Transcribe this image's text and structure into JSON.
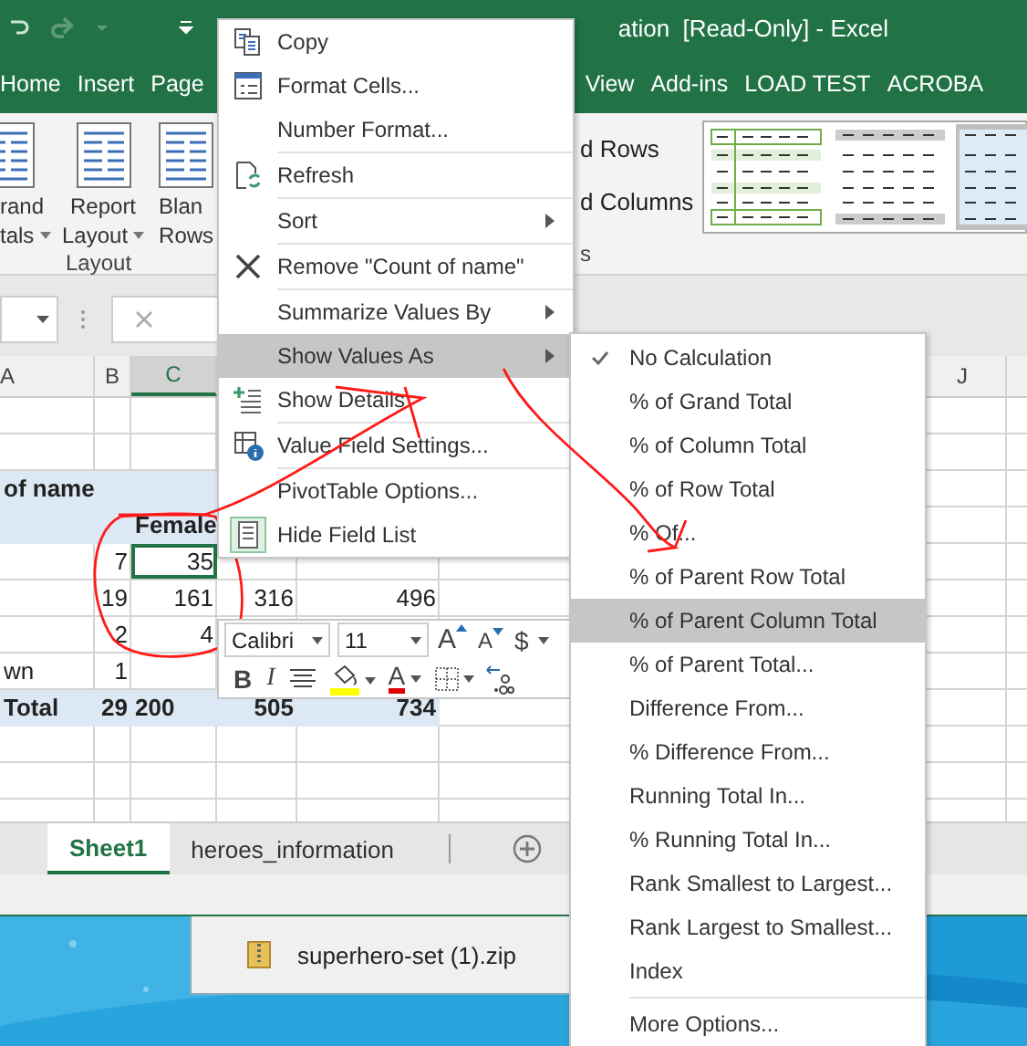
{
  "title_bar": {
    "title": "ation  [Read-Only] - Excel"
  },
  "ribbon_tabs": [
    "Home",
    "Insert",
    "Page",
    "View",
    "Add-ins",
    "LOAD TEST",
    "ACROBA"
  ],
  "ribbon": {
    "buttons": [
      {
        "lines": [
          "rand",
          "tals"
        ],
        "dropdown": true
      },
      {
        "lines": [
          "Report",
          "Layout"
        ],
        "dropdown": true
      },
      {
        "lines": [
          "Blan",
          "Rows"
        ],
        "dropdown": false
      }
    ],
    "group": "Layout",
    "options": [
      "d Rows",
      "d Columns"
    ],
    "options_group": "s"
  },
  "column_headers": [
    {
      "label": "A",
      "selected": false
    },
    {
      "label": "B",
      "selected": false
    },
    {
      "label": "C",
      "selected": true
    },
    {
      "label": "J",
      "selected": false
    }
  ],
  "rows": [
    {
      "band": true,
      "cells": [
        {
          "text": "of name",
          "selected": false
        },
        null,
        null,
        null,
        null
      ]
    },
    {
      "band": true,
      "cells": [
        null,
        null,
        {
          "text": "Female",
          "selected": false
        },
        null,
        null
      ]
    },
    {
      "band": false,
      "cells": [
        null,
        {
          "text": "7",
          "selected": false
        },
        {
          "text": "35",
          "selected": true
        },
        null,
        null
      ]
    },
    {
      "band": false,
      "cells": [
        null,
        {
          "text": "19",
          "selected": false
        },
        {
          "text": "161",
          "selected": false
        },
        {
          "text": "316",
          "selected": false
        },
        {
          "text": "496",
          "selected": false
        }
      ]
    },
    {
      "band": false,
      "cells": [
        null,
        {
          "text": "2",
          "selected": false
        },
        {
          "text": "4",
          "selected": false
        },
        null,
        null
      ]
    },
    {
      "band": false,
      "cells": [
        {
          "text": "wn",
          "selected": false
        },
        {
          "text": "1",
          "selected": false
        },
        null,
        null,
        null
      ]
    },
    {
      "band": true,
      "cells": [
        {
          "text": "Total",
          "selected": false
        },
        {
          "text": "29",
          "selected": false
        },
        {
          "text": "200",
          "selected": false
        },
        {
          "text": "505",
          "selected": false
        },
        {
          "text": "734",
          "selected": false
        }
      ]
    }
  ],
  "context_menu": {
    "sections": [
      [
        {
          "label": "Copy",
          "kind": "copy",
          "submenu": false,
          "selected": false
        },
        {
          "label": "Format Cells...",
          "kind": "format",
          "submenu": false,
          "selected": false
        },
        {
          "label": "Number Format...",
          "kind": "plain",
          "submenu": false,
          "selected": false
        }
      ],
      [
        {
          "label": "Refresh",
          "kind": "refresh",
          "submenu": false,
          "selected": false
        }
      ],
      [
        {
          "label": "Sort",
          "kind": "plain",
          "submenu": true,
          "selected": false
        }
      ],
      [
        {
          "label": "Remove \"Count of name\"",
          "kind": "remove",
          "submenu": false,
          "selected": false
        }
      ],
      [
        {
          "label": "Summarize Values By",
          "kind": "plain",
          "submenu": true,
          "selected": false
        },
        {
          "label": "Show Values As",
          "kind": "plain",
          "submenu": true,
          "selected": true
        },
        {
          "label": "Show Details",
          "kind": "details",
          "submenu": false,
          "selected": false
        }
      ],
      [
        {
          "label": "Value Field Settings...",
          "kind": "settings",
          "submenu": false,
          "selected": false
        }
      ],
      [
        {
          "label": "PivotTable Options...",
          "kind": "plain",
          "submenu": false,
          "selected": false
        },
        {
          "label": "Hide Field List",
          "kind": "fieldlist",
          "submenu": false,
          "selected": false
        }
      ]
    ]
  },
  "mini_toolbar": {
    "font": "Calibri",
    "size": "11",
    "row1": [
      {
        "kind": "grow",
        "label": "A"
      },
      {
        "kind": "shrink",
        "label": "A"
      },
      {
        "kind": "currency",
        "label": "$"
      }
    ],
    "row2": [
      {
        "kind": "bold",
        "label": "B"
      },
      {
        "kind": "italic",
        "label": "I"
      },
      {
        "kind": "center"
      },
      {
        "kind": "fill"
      },
      {
        "kind": "fontcolor",
        "label": "A"
      },
      {
        "kind": "borders"
      },
      {
        "kind": "decimal"
      }
    ]
  },
  "submenu": {
    "sections": [
      [
        {
          "label": "No Calculation",
          "checked": true,
          "selected": false
        },
        {
          "label": "% of Grand Total",
          "checked": false,
          "selected": false
        },
        {
          "label": "% of Column Total",
          "checked": false,
          "selected": false
        },
        {
          "label": "% of Row Total",
          "checked": false,
          "selected": false
        },
        {
          "label": "% Of...",
          "checked": false,
          "selected": false
        },
        {
          "label": "% of Parent Row Total",
          "checked": false,
          "selected": false
        },
        {
          "label": "% of Parent Column Total",
          "checked": false,
          "selected": true
        },
        {
          "label": "% of Parent Total...",
          "checked": false,
          "selected": false
        },
        {
          "label": "Difference From...",
          "checked": false,
          "selected": false
        },
        {
          "label": "% Difference From...",
          "checked": false,
          "selected": false
        },
        {
          "label": "Running Total In...",
          "checked": false,
          "selected": false
        },
        {
          "label": "% Running Total In...",
          "checked": false,
          "selected": false
        },
        {
          "label": "Rank Smallest to Largest...",
          "checked": false,
          "selected": false
        },
        {
          "label": "Rank Largest to Smallest...",
          "checked": false,
          "selected": false
        },
        {
          "label": "Index",
          "checked": false,
          "selected": false
        }
      ],
      [
        {
          "label": "More Options...",
          "checked": false,
          "selected": false
        }
      ]
    ]
  },
  "sheet_tabs": [
    {
      "label": "Sheet1",
      "selected": true
    },
    {
      "label": "heroes_information",
      "selected": false
    }
  ],
  "taskbar_window": {
    "file": "superhero-set (1).zip"
  }
}
